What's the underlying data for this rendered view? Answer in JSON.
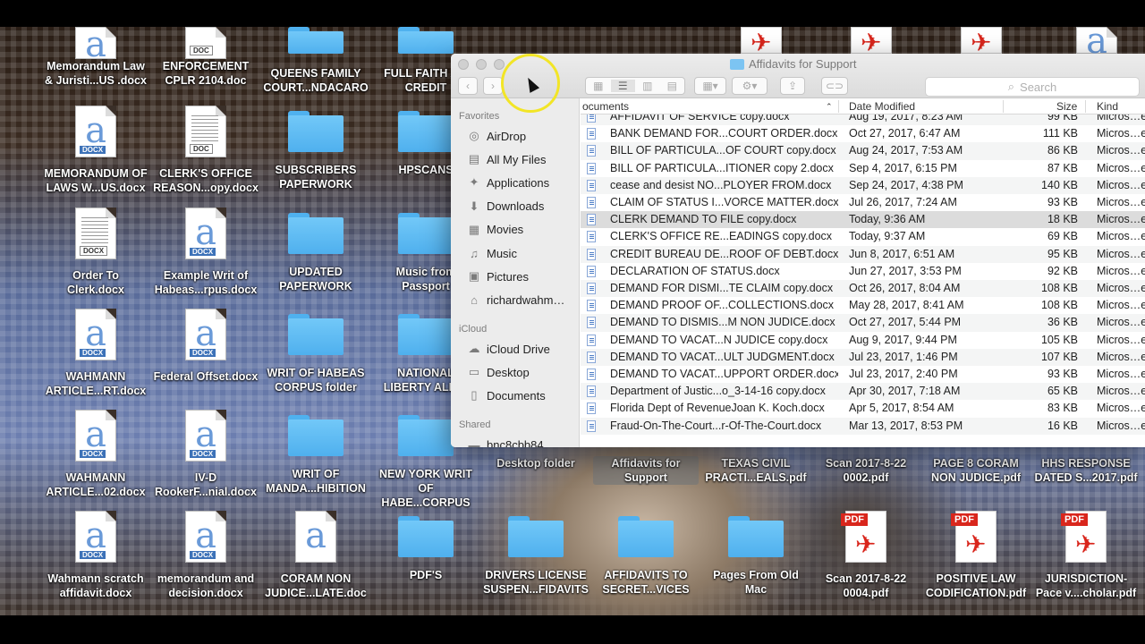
{
  "window": {
    "title": "Affidavits for Support",
    "search_placeholder": "Search"
  },
  "sidebar": {
    "favorites_header": "Favorites",
    "favorites": [
      {
        "label": "AirDrop",
        "icon": "airdrop-icon"
      },
      {
        "label": "All My Files",
        "icon": "all-files-icon"
      },
      {
        "label": "Applications",
        "icon": "applications-icon"
      },
      {
        "label": "Downloads",
        "icon": "downloads-icon"
      },
      {
        "label": "Movies",
        "icon": "movies-icon"
      },
      {
        "label": "Music",
        "icon": "music-icon"
      },
      {
        "label": "Pictures",
        "icon": "pictures-icon"
      },
      {
        "label": "richardwahm…",
        "icon": "home-icon"
      }
    ],
    "icloud_header": "iCloud",
    "icloud": [
      {
        "label": "iCloud Drive",
        "icon": "cloud-icon"
      },
      {
        "label": "Desktop",
        "icon": "desktop-icon"
      },
      {
        "label": "Documents",
        "icon": "documents-icon"
      }
    ],
    "shared_header": "Shared",
    "shared": [
      {
        "label": "bnc8cbb84…",
        "icon": "computer-icon"
      }
    ]
  },
  "columns": {
    "name": "ocuments",
    "date": "Date Modified",
    "size": "Size",
    "kind": "Kind"
  },
  "files": [
    {
      "name": "AFFIDAVIT OF SERVICE copy.docx",
      "date": "Aug 19, 2017, 8:23 AM",
      "size": "99 KB",
      "kind": "Micros…ent"
    },
    {
      "name": "BANK DEMAND FOR...COURT ORDER.docx",
      "date": "Oct 27, 2017, 6:47 AM",
      "size": "111 KB",
      "kind": "Micros…ent"
    },
    {
      "name": "BILL OF PARTICULA...OF COURT copy.docx",
      "date": "Aug 24, 2017, 7:53 AM",
      "size": "86 KB",
      "kind": "Micros…ent"
    },
    {
      "name": "BILL OF PARTICULA...ITIONER copy 2.docx",
      "date": "Sep 4, 2017, 6:15 PM",
      "size": "87 KB",
      "kind": "Micros…ent"
    },
    {
      "name": "cease and desist NO...PLOYER FROM.docx",
      "date": "Sep 24, 2017, 4:38 PM",
      "size": "140 KB",
      "kind": "Micros…ent"
    },
    {
      "name": "CLAIM OF STATUS I...VORCE MATTER.docx",
      "date": "Jul 26, 2017, 7:24 AM",
      "size": "93 KB",
      "kind": "Micros…ent"
    },
    {
      "name": "CLERK DEMAND TO FILE copy.docx",
      "date": "Today, 9:36 AM",
      "size": "18 KB",
      "kind": "Micros…ent"
    },
    {
      "name": "CLERK'S OFFICE RE...EADINGS   copy.docx",
      "date": "Today, 9:37 AM",
      "size": "69 KB",
      "kind": "Micros…ent"
    },
    {
      "name": "CREDIT BUREAU DE...ROOF OF DEBT.docx",
      "date": "Jun 8, 2017, 6:51 AM",
      "size": "95 KB",
      "kind": "Micros…ent"
    },
    {
      "name": "DECLARATION OF STATUS.docx",
      "date": "Jun 27, 2017, 3:53 PM",
      "size": "92 KB",
      "kind": "Micros…ent"
    },
    {
      "name": "DEMAND FOR DISMI...TE CLAIM copy.docx",
      "date": "Oct 26, 2017, 8:04 AM",
      "size": "108 KB",
      "kind": "Micros…ent"
    },
    {
      "name": "DEMAND PROOF OF...COLLECTIONS.docx",
      "date": "May 28, 2017, 8:41 AM",
      "size": "108 KB",
      "kind": "Micros…ent"
    },
    {
      "name": "DEMAND TO DISMIS...M NON JUDICE.docx",
      "date": "Oct 27, 2017, 5:44 PM",
      "size": "36 KB",
      "kind": "Micros…ent"
    },
    {
      "name": "DEMAND TO VACAT...N JUDICE copy.docx",
      "date": "Aug 9, 2017, 9:44 PM",
      "size": "105 KB",
      "kind": "Micros…ent"
    },
    {
      "name": "DEMAND TO VACAT...ULT JUDGMENT.docx",
      "date": "Jul 23, 2017, 1:46 PM",
      "size": "107 KB",
      "kind": "Micros…ent"
    },
    {
      "name": "DEMAND TO VACAT...UPPORT ORDER.docx",
      "date": "Jul 23, 2017, 2:40 PM",
      "size": "93 KB",
      "kind": "Micros…ent"
    },
    {
      "name": "Department of Justic...o_3-14-16 copy.docx",
      "date": "Apr 30, 2017, 7:18 AM",
      "size": "65 KB",
      "kind": "Micros…ent"
    },
    {
      "name": "Florida Dept of RevenueJoan K. Koch.docx",
      "date": "Apr 5, 2017, 8:54 AM",
      "size": "83 KB",
      "kind": "Micros…ent"
    },
    {
      "name": "Fraud-On-The-Court...r-Of-The-Court.docx",
      "date": "Mar 13, 2017, 8:53 PM",
      "size": "16 KB",
      "kind": "Micros…ent"
    }
  ],
  "selected_file_index": 6,
  "desktop": {
    "icons": [
      {
        "label": "Memorandum Law & Juristi...US .docx",
        "type": "docx"
      },
      {
        "label": "ENFORCEMENT CPLR 2104.doc",
        "type": "doc"
      },
      {
        "label": "QUEENS FAMILY COURT...NDACARO",
        "type": "folder"
      },
      {
        "label": "FULL FAITH A... CREDIT",
        "type": "folder"
      },
      {
        "label": "MEMORANDUM OF LAWS W...US.docx",
        "type": "docx"
      },
      {
        "label": "CLERK'S OFFICE REASON...opy.docx",
        "type": "doc"
      },
      {
        "label": "SUBSCRIBERS PAPERWORK",
        "type": "folder"
      },
      {
        "label": "HPSCANS",
        "type": "folder"
      },
      {
        "label": "Order To Clerk.docx",
        "type": "doc"
      },
      {
        "label": "Example Writ of Habeas...rpus.docx",
        "type": "docx"
      },
      {
        "label": "UPDATED PAPERWORK",
        "type": "folder"
      },
      {
        "label": "Music from Passport",
        "type": "folder"
      },
      {
        "label": "WAHMANN ARTICLE...RT.docx",
        "type": "docx"
      },
      {
        "label": "Federal Offset.docx",
        "type": "docx"
      },
      {
        "label": "WRIT OF HABEAS CORPUS folder",
        "type": "folder"
      },
      {
        "label": "NATIONAL LIBERTY ALLI...",
        "type": "folder"
      },
      {
        "label": "WAHMANN ARTICLE...02.docx",
        "type": "docx"
      },
      {
        "label": "IV-D RookerF...nial.docx",
        "type": "docx"
      },
      {
        "label": "WRIT OF MANDA...HIBITION",
        "type": "folder"
      },
      {
        "label": "NEW YORK WRIT OF HABE...CORPUS",
        "type": "folder"
      },
      {
        "label": "Desktop folder",
        "type": "folder"
      },
      {
        "label": "Affidavits for Support",
        "type": "folder"
      },
      {
        "label": "TEXAS CIVIL PRACTI...EALS.pdf",
        "type": "pdf"
      },
      {
        "label": "Scan 2017-8-22 0002.pdf",
        "type": "pdf"
      },
      {
        "label": "PAGE 8 CORAM NON JUDICE.pdf",
        "type": "pdf"
      },
      {
        "label": "HHS RESPONSE DATED S...2017.pdf",
        "type": "pdf"
      },
      {
        "label": "Wahmann scratch affidavit.docx",
        "type": "docx"
      },
      {
        "label": "memorandum and decision.docx",
        "type": "docx"
      },
      {
        "label": "CORAM NON JUDICE...LATE.doc",
        "type": "docx"
      },
      {
        "label": "PDF'S",
        "type": "folder"
      },
      {
        "label": "DRIVERS LICENSE SUSPEN...FIDAVITS",
        "type": "folder"
      },
      {
        "label": "AFFIDAVITS TO SECRET...VICES",
        "type": "folder"
      },
      {
        "label": "Pages From Old Mac",
        "type": "folder"
      },
      {
        "label": "Scan 2017-8-22 0004.pdf",
        "type": "pdf"
      },
      {
        "label": "POSITIVE LAW CODIFICATION.pdf",
        "type": "pdf"
      },
      {
        "label": "JURISDICTION- Pace v....cholar.pdf",
        "type": "pdf"
      }
    ],
    "ext_labels": {
      "docx": "DOCX",
      "doc": "DOC",
      "pdf": "PDF"
    }
  }
}
